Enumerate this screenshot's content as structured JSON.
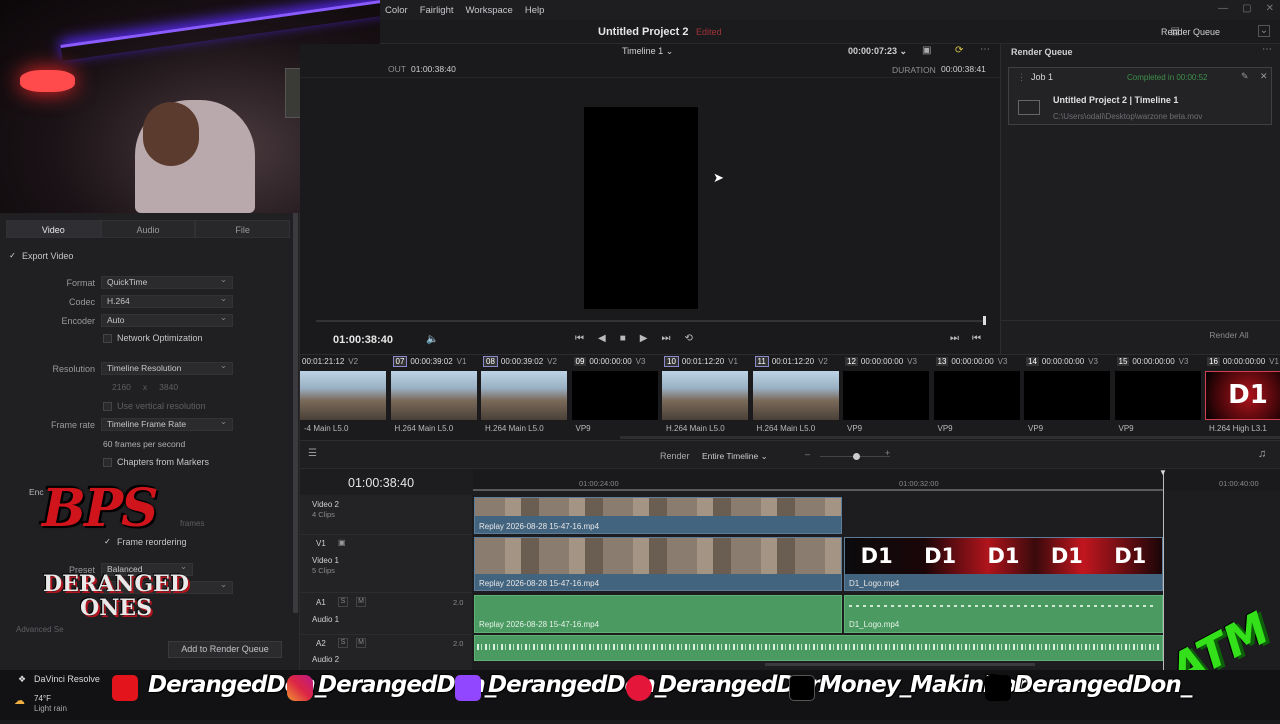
{
  "menu": [
    "Color",
    "Fairlight",
    "Workspace",
    "Help"
  ],
  "project": {
    "title": "Untitled Project 2",
    "status": "Edited"
  },
  "render_queue_top": "Render Queue",
  "viewer": {
    "timeline_name": "Timeline 1",
    "timecode_top": "00:00:07:23",
    "out_label": "OUT",
    "out_tc": "01:00:38:40",
    "duration_label": "DURATION",
    "duration_tc": "00:00:38:41",
    "current_tc": "01:00:38:40"
  },
  "render_queue": {
    "title": "Render Queue",
    "job_label": "Job 1",
    "job_status": "Completed in 00:00:52",
    "job_title": "Untitled Project 2 | Timeline 1",
    "job_path": "C:\\Users\\odali\\Desktop\\warzone beta.mov",
    "render_all": "Render All"
  },
  "left": {
    "tabs": [
      "Video",
      "Audio",
      "File"
    ],
    "export_video": "Export Video",
    "format_label": "Format",
    "format_value": "QuickTime",
    "codec_label": "Codec",
    "codec_value": "H.264",
    "encoder_label": "Encoder",
    "encoder_value": "Auto",
    "network_opt": "Network Optimization",
    "resolution_label": "Resolution",
    "resolution_value": "Timeline Resolution",
    "res_w": "2160",
    "res_x": "x",
    "res_h": "3840",
    "use_vertical": "Use vertical resolution",
    "framerate_label": "Frame rate",
    "framerate_value": "Timeline Frame Rate",
    "fps_text": "60 frames per second",
    "chapters": "Chapters from Markers",
    "enc_label": "Enc",
    "frames_text": "frames",
    "frame_reordering": "Frame reordering",
    "preset_label": "Preset",
    "preset_value": "Balanced",
    "advanced": "Advanced Se",
    "add_to_queue": "Add to Render Queue"
  },
  "clips": [
    {
      "num": "",
      "tc": "00:01:21:12",
      "track": "V2",
      "codec": "-4 Main L5.0",
      "kind": "game"
    },
    {
      "num": "07",
      "tc": "00:00:39:02",
      "track": "V1",
      "codec": "H.264 Main L5.0",
      "kind": "game"
    },
    {
      "num": "08",
      "tc": "00:00:39:02",
      "track": "V2",
      "codec": "H.264 Main L5.0",
      "kind": "game"
    },
    {
      "num": "09",
      "tc": "00:00:00:00",
      "track": "V3",
      "codec": "VP9",
      "kind": "black"
    },
    {
      "num": "10",
      "tc": "00:01:12:20",
      "track": "V1",
      "codec": "H.264 Main L5.0",
      "kind": "game"
    },
    {
      "num": "11",
      "tc": "00:01:12:20",
      "track": "V2",
      "codec": "H.264 Main L5.0",
      "kind": "game"
    },
    {
      "num": "12",
      "tc": "00:00:00:00",
      "track": "V3",
      "codec": "VP9",
      "kind": "black"
    },
    {
      "num": "13",
      "tc": "00:00:00:00",
      "track": "V3",
      "codec": "VP9",
      "kind": "black"
    },
    {
      "num": "14",
      "tc": "00:00:00:00",
      "track": "V3",
      "codec": "VP9",
      "kind": "black"
    },
    {
      "num": "15",
      "tc": "00:00:00:00",
      "track": "V3",
      "codec": "VP9",
      "kind": "black"
    },
    {
      "num": "16",
      "tc": "00:00:00:00",
      "track": "V1",
      "codec": "H.264 High L3.1",
      "kind": "d1"
    }
  ],
  "timeline": {
    "render_label": "Render",
    "render_scope": "Entire Timeline",
    "tc": "01:00:38:40",
    "ruler": [
      "01:00:24:00",
      "01:00:32:00",
      "01:00:40:00"
    ],
    "tracks": {
      "video2_name": "Video 2",
      "video2_clips": "4 Clips",
      "v1_id": "V1",
      "video1_name": "Video 1",
      "video1_clips": "5 Clips",
      "a1_id": "A1",
      "audio1_name": "Audio 1",
      "a1_level": "2.0",
      "a2_id": "A2",
      "audio2_name": "Audio 2",
      "a2_level": "2.0",
      "s": "S",
      "m": "M"
    },
    "clip_replay": "Replay 2026-08-28 15-47-16.mp4",
    "clip_logo": "D1_Logo.mp4",
    "logo_text": "D1"
  },
  "overlay": {
    "bps": "BPS",
    "deranged": "DERANGED ONES",
    "atm": "ATM",
    "davinci": "DaVinci Resolve",
    "weather_temp": "74°F",
    "weather_desc": "Light rain",
    "socials": [
      "DerangedDon_",
      "DerangedDon_",
      "DerangedDon_",
      "DerangedDon",
      "Money_MakinDon",
      "DerangedDon_"
    ]
  }
}
